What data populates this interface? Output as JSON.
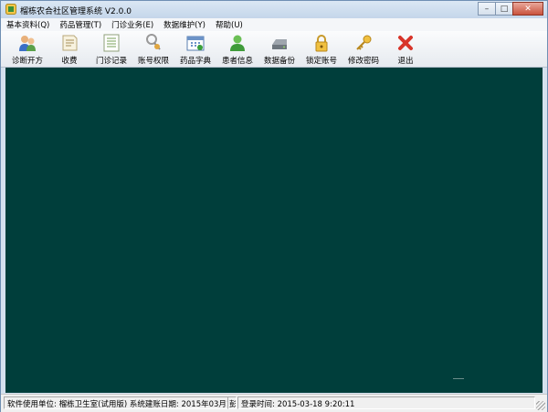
{
  "window": {
    "title": "榴栋农合社区管理系统 V2.0.0"
  },
  "menu": [
    {
      "label": "基本资料(Q)"
    },
    {
      "label": "药品管理(T)"
    },
    {
      "label": "门诊业务(E)"
    },
    {
      "label": "数据维护(Y)"
    },
    {
      "label": "帮助(U)"
    }
  ],
  "toolbar": [
    {
      "label": "诊断开方",
      "icon": "doctor-icon"
    },
    {
      "label": "收费",
      "icon": "notepad-icon"
    },
    {
      "label": "门诊记录",
      "icon": "records-icon"
    },
    {
      "label": "账号权限",
      "icon": "key-person-icon"
    },
    {
      "label": "药品字典",
      "icon": "calendar-icon"
    },
    {
      "label": "患者信息",
      "icon": "person-icon"
    },
    {
      "label": "数据备份",
      "icon": "disk-icon"
    },
    {
      "label": "锁定账号",
      "icon": "lock-icon"
    },
    {
      "label": "修改密码",
      "icon": "key-icon"
    },
    {
      "label": "退出",
      "icon": "exit-icon"
    }
  ],
  "status": {
    "unit": "软件使用单位: 榴栋卫生室(试用版)",
    "build_date": "系统建账日期: 2015年03月18日",
    "extra": "彭",
    "login_time": "登录时间: 2015-03-18  9:20:11"
  }
}
